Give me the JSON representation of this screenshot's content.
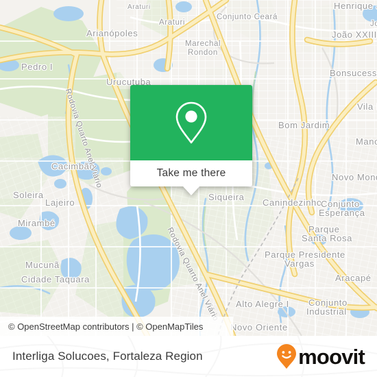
{
  "map": {
    "attribution": "© OpenStreetMap contributors | © OpenMapTiles",
    "colors": {
      "land": "#f4f2ee",
      "green": "#d8e8c6",
      "water": "#a9d0ef",
      "highway": "#f6de8f",
      "road": "#ffffff",
      "label": "#9b9b9b"
    },
    "place_labels": [
      {
        "name": "Araturi",
        "text": "Araturi"
      },
      {
        "name": "Araturi",
        "text": "Araturi"
      },
      {
        "name": "Conjunto Ceará",
        "text": "Conjunto Ceará"
      },
      {
        "name": "Arianópoles",
        "text": "Arianópoles"
      },
      {
        "name": "Marechal Rondon",
        "text": "Marechal Rondon"
      },
      {
        "name": "Henrique Jor",
        "text": "Henrique Jor"
      },
      {
        "name": "João XXIII",
        "text": "João XXIII"
      },
      {
        "name": "Jo",
        "text": "Jo"
      },
      {
        "name": "Pedro I",
        "text": "Pedro I"
      },
      {
        "name": "Bonsucesso",
        "text": "Bonsucesso"
      },
      {
        "name": "Urucutuba",
        "text": "Urucutuba"
      },
      {
        "name": "Vila I",
        "text": "Vila I"
      },
      {
        "name": "Bom Jardim",
        "text": "Bom Jardim"
      },
      {
        "name": "Manoe",
        "text": "Manoe"
      },
      {
        "name": "Cacimbão",
        "text": "Cacimbão"
      },
      {
        "name": "Soleira",
        "text": "Soleira"
      },
      {
        "name": "Lajeiro",
        "text": "Lajeiro"
      },
      {
        "name": "Novo Mondu",
        "text": "Novo Mondu"
      },
      {
        "name": "Siqueira",
        "text": "Siqueira"
      },
      {
        "name": "Canindezinho",
        "text": "Canindezinho"
      },
      {
        "name": "Conjunto Esperança",
        "text": "Conjunto\nEsperança"
      },
      {
        "name": "Mirambé",
        "text": "Mirambé"
      },
      {
        "name": "Parque Santa Rosa",
        "text": "Parque\nSanta Rosa"
      },
      {
        "name": "Parque Presidente Vargas",
        "text": "Parque Presidente\nVargas"
      },
      {
        "name": "Mucunã",
        "text": "Mucunã"
      },
      {
        "name": "Aracapé",
        "text": "Aracapé"
      },
      {
        "name": "Cidade Taquara",
        "text": "Cidade Taquara"
      },
      {
        "name": "Alto Alegre I",
        "text": "Alto Alegre I"
      },
      {
        "name": "Conjunto Industrial",
        "text": "Conjunto\nIndustrial"
      },
      {
        "name": "Novo Oriente",
        "text": "Novo Oriente"
      }
    ],
    "labels": {
      "araturi_1": "Araturi",
      "araturi_2": "Araturi",
      "conjunto_ceara": "Conjunto Ceará",
      "arianopoles": "Arianópoles",
      "marechal": "Marechal",
      "rondon": "Rondon",
      "henrique_jor": "Henrique Jor",
      "joao_xxiii": "João XXIII",
      "jo_cut": "Jo",
      "pedro_i": "Pedro I",
      "bonsucesso": "Bonsucesso",
      "urucutuba": "Urucutuba",
      "vila_i": "Vila I",
      "bom_jardim": "Bom Jardim",
      "manoe": "Manoe",
      "cacimbao": "Cacimbão",
      "soleira": "Soleira",
      "lajeiro": "Lajeiro",
      "novo_mondu": "Novo Mondu",
      "siqueira": "Siqueira",
      "canindezinho": "Canindezinho",
      "conjunto_esperanca_1": "Conjunto",
      "conjunto_esperanca_2": "Esperança",
      "mirambe": "Mirambé",
      "parque_santa_rosa_1": "Parque",
      "parque_santa_rosa_2": "Santa Rosa",
      "parque_presidente_1": "Parque Presidente",
      "parque_presidente_2": "Vargas",
      "mucuna": "Mucunã",
      "aracape": "Aracapé",
      "cidade_taquara": "Cidade Taquara",
      "alto_alegre_i": "Alto Alegre I",
      "conjunto_industrial_1": "Conjunto",
      "conjunto_industrial_2": "Industrial",
      "novo_oriente": "Novo Oriente",
      "road_anel_1": "Rodovia Quarto Anel Viário",
      "road_anel_2": "Rodovia Quarto Anel Viário"
    }
  },
  "popup": {
    "icon": "location-pin-icon",
    "accent_color": "#22b35d",
    "button_label": "Take me there"
  },
  "footer": {
    "title": "Interliga Solucoes, Fortaleza Region",
    "brand_name": "moovit",
    "brand_icon": "moovit-smiley-pin-icon",
    "brand_color": "#f4851f",
    "brand_text_color": "#12100e"
  }
}
